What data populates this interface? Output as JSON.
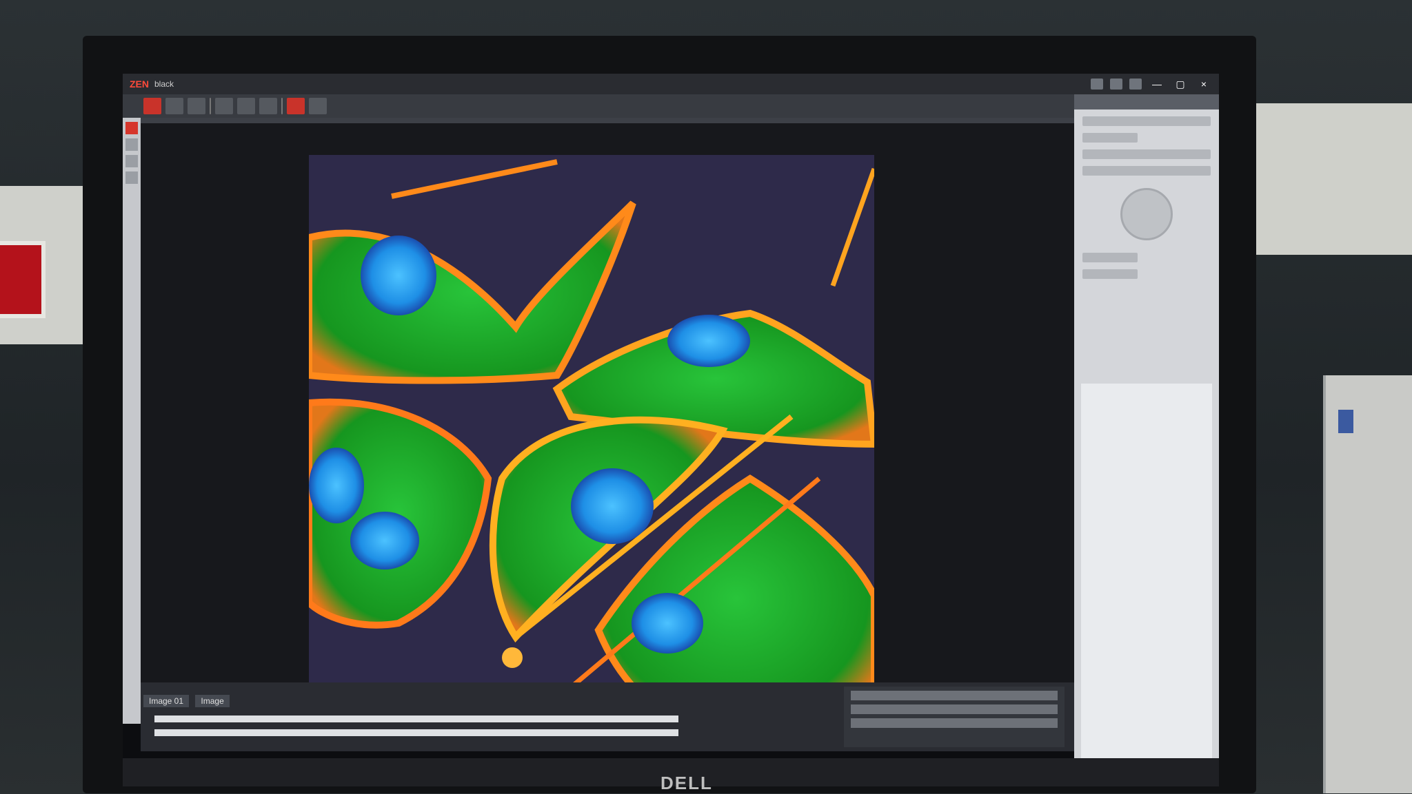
{
  "app": {
    "logo": "ZEN",
    "mode": "black",
    "window_buttons": [
      "—",
      "▢",
      "×"
    ]
  },
  "monitor": {
    "brand": "DELL"
  },
  "file_tab": {
    "name": "Image 01",
    "extra": "Image"
  },
  "colors": {
    "accent": "#ff4a3a",
    "actin": "#ff7a1a",
    "tubulin": "#20c030",
    "nucleus": "#2aa7ff",
    "screen_bg": "#0c0d10"
  }
}
